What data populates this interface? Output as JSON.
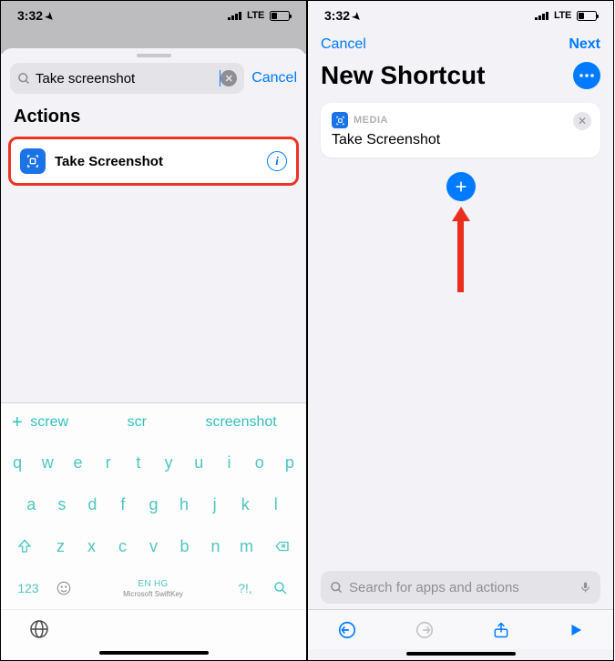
{
  "status_time": "3:32",
  "carrier_label": "LTE",
  "left": {
    "search_value": "Take screenshot",
    "cancel": "Cancel",
    "section": "Actions",
    "action_label": "Take Screenshot",
    "suggestions": [
      "screw",
      "scr",
      "screenshot"
    ],
    "keyboard": {
      "row1": [
        "q",
        "w",
        "e",
        "r",
        "t",
        "y",
        "u",
        "i",
        "o",
        "p"
      ],
      "row2": [
        "a",
        "s",
        "d",
        "f",
        "g",
        "h",
        "j",
        "k",
        "l"
      ],
      "row3": [
        "z",
        "x",
        "c",
        "v",
        "b",
        "n",
        "m"
      ],
      "num_key": "123",
      "sym_key": "?!,",
      "lang": "EN HG",
      "brand": "Microsoft SwiftKey"
    }
  },
  "right": {
    "cancel": "Cancel",
    "next": "Next",
    "title": "New Shortcut",
    "card_category": "MEDIA",
    "card_text": "Take Screenshot",
    "search_placeholder": "Search for apps and actions"
  }
}
